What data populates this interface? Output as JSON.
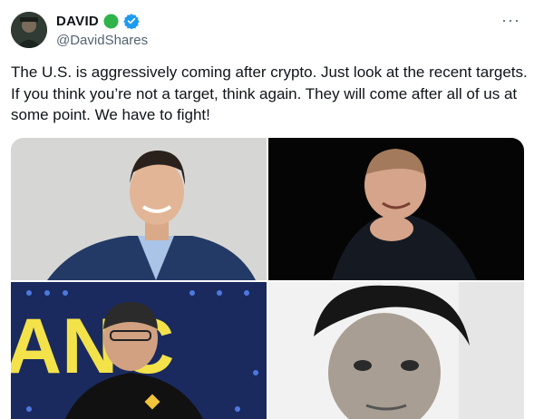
{
  "author": {
    "display_name": "DAVID",
    "handle": "@DavidShares",
    "avatar_icon": "avatar",
    "badges": [
      "green-circle-icon",
      "verified-check-icon"
    ]
  },
  "tweet": {
    "text": "The U.S. is aggressively coming after crypto. Just look at the recent targets. If you think you’re not a target, think again. They will come after all of us at some point. We have to fight!"
  },
  "more_label": "···",
  "media": [
    {
      "name": "photo-smiling-man-suit"
    },
    {
      "name": "photo-man-hand-on-chin"
    },
    {
      "name": "photo-man-binance-backdrop",
      "backdrop_text": "ANC"
    },
    {
      "name": "photo-curly-hair-man-bw"
    }
  ],
  "colors": {
    "verified": "#1d9bf0",
    "status": "#2fb34a",
    "handle": "#536471"
  }
}
